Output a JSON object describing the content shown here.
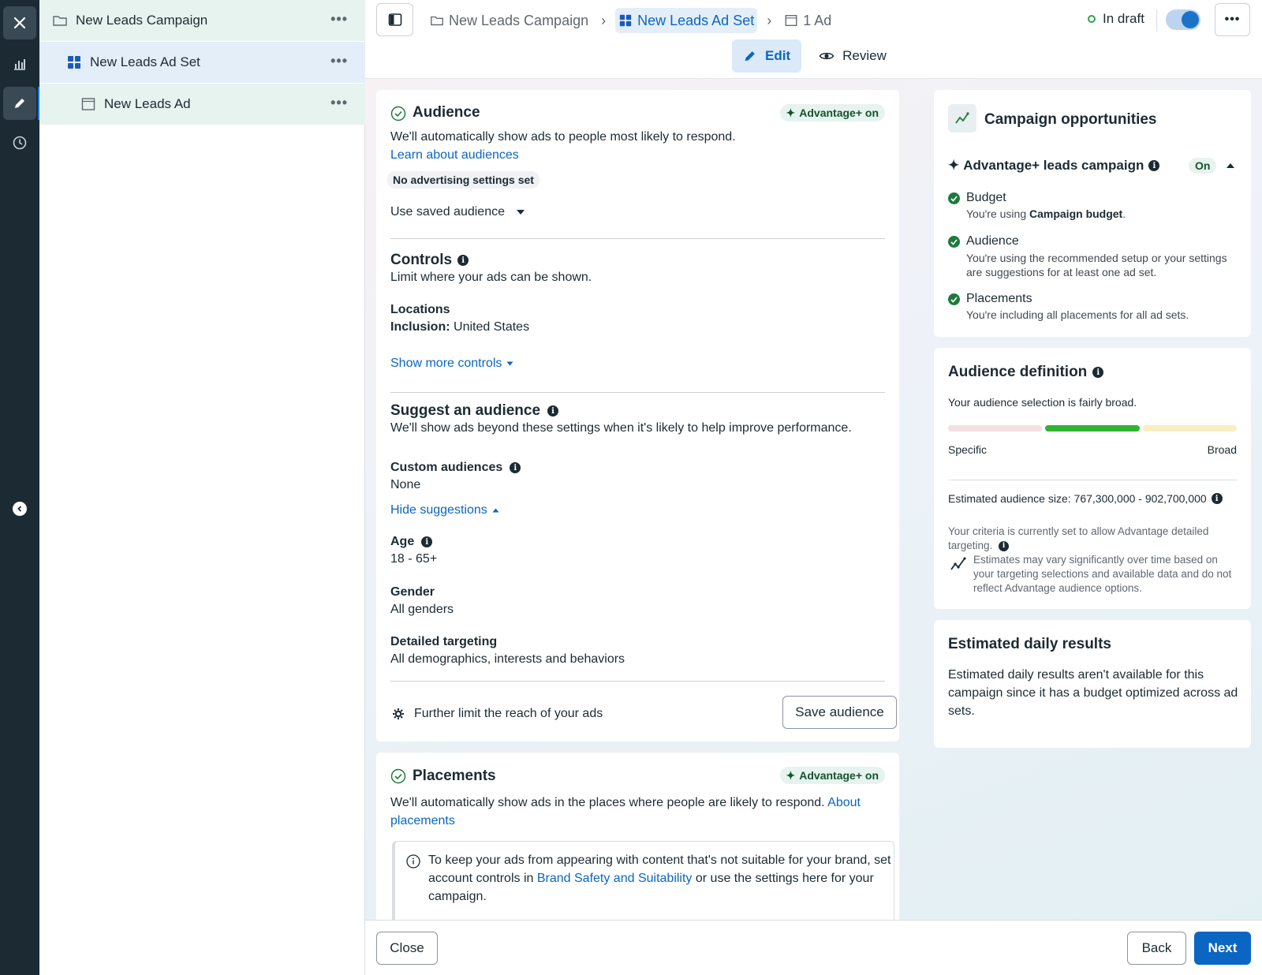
{
  "tree": {
    "campaign": "New Leads Campaign",
    "adset": "New Leads Ad Set",
    "ad": "New Leads Ad",
    "more": "•••"
  },
  "header": {
    "crumb_campaign": "New Leads Campaign",
    "crumb_adset": "New Leads Ad Set",
    "crumb_ad": "1 Ad",
    "status": "In draft",
    "more": "•••",
    "tab_edit": "Edit",
    "tab_review": "Review"
  },
  "audience": {
    "title": "Audience",
    "badge": "Advantage+ on",
    "desc": "We'll automatically show ads to people most likely to respond.",
    "learn": "Learn about audiences",
    "no_settings": "No advertising settings set",
    "saved": "Use saved audience",
    "controls_title": "Controls",
    "controls_desc": "Limit where your ads can be shown.",
    "locations_label": "Locations",
    "inclusion_label": "Inclusion:",
    "inclusion_value": "United States",
    "show_more": "Show more controls",
    "suggest_title": "Suggest an audience",
    "suggest_desc": "We'll show ads beyond these settings when it's likely to help improve performance.",
    "custom_label": "Custom audiences",
    "custom_value": "None",
    "hide": "Hide suggestions",
    "age_label": "Age",
    "age_value": "18 - 65+",
    "gender_label": "Gender",
    "gender_value": "All genders",
    "targeting_label": "Detailed targeting",
    "targeting_value": "All demographics, interests and behaviors",
    "further": "Further limit the reach of your ads",
    "save_btn": "Save audience"
  },
  "placements": {
    "title": "Placements",
    "badge": "Advantage+ on",
    "desc": "We'll automatically show ads in the places where people are likely to respond.",
    "about_link": "About placements",
    "notice_pre": "To keep your ads from appearing with content that's not suitable for your brand, set account controls in",
    "notice_link": "Brand Safety and Suitability",
    "notice_post": "or use the settings here for your campaign."
  },
  "opportunities": {
    "title": "Campaign opportunities",
    "adv_title": "Advantage+ leads campaign",
    "adv_status": "On",
    "items": [
      {
        "title": "Budget",
        "desc_pre": "You're using ",
        "desc_bold": "Campaign budget",
        "desc_post": "."
      },
      {
        "title": "Audience",
        "desc_pre": "You're using the recommended setup or your settings are suggestions for at least one ad set.",
        "desc_bold": "",
        "desc_post": ""
      },
      {
        "title": "Placements",
        "desc_pre": "You're including all placements for all ad sets.",
        "desc_bold": "",
        "desc_post": ""
      }
    ]
  },
  "definition": {
    "title": "Audience definition",
    "summary": "Your audience selection is fairly broad.",
    "specific": "Specific",
    "broad": "Broad",
    "size_label": "Estimated audience size: 767,300,000 - 902,700,000",
    "criteria": "Your criteria is currently set to allow Advantage detailed targeting.",
    "estimates": "Estimates may vary significantly over time based on your targeting selections and available data and do not reflect Advantage audience options.",
    "gauge_colors": [
      "#f5dfe3",
      "#2fb52f",
      "#f8eec2"
    ]
  },
  "daily": {
    "title": "Estimated daily results",
    "desc": "Estimated daily results aren't available for this campaign since it has a budget optimized across ad sets."
  },
  "footer": {
    "close": "Close",
    "back": "Back",
    "next": "Next"
  },
  "colors": {
    "accent": "#0a66c2",
    "rail": "#1c2b33",
    "success": "#1e7a3e"
  }
}
